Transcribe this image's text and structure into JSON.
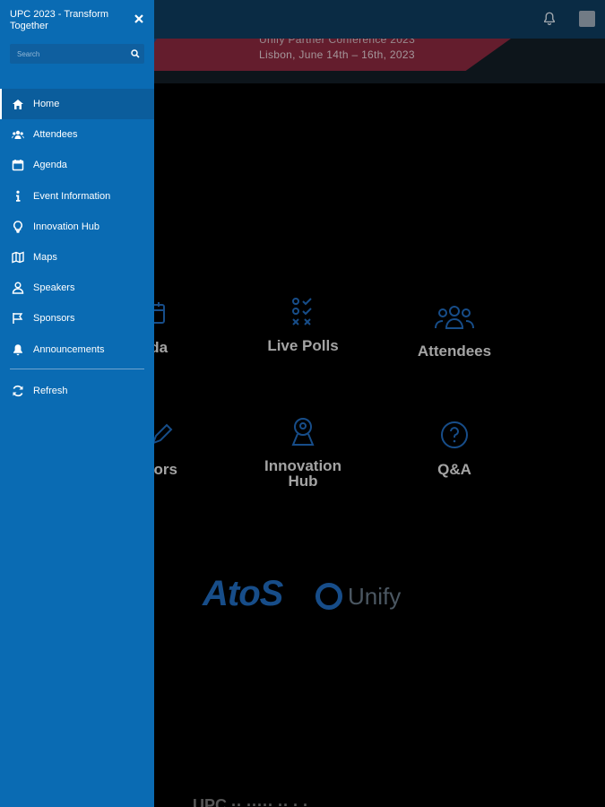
{
  "background": {
    "banner": {
      "line1": "Unify Partner Conference 2023",
      "line2": "Lisbon, June 14th – 16th, 2023"
    },
    "tiles": [
      {
        "label": "nda",
        "icon": "calendar-icon"
      },
      {
        "label": "Live Polls",
        "icon": "poll-checklist-icon"
      },
      {
        "label": "Attendees",
        "icon": "group-icon"
      },
      {
        "label": "sors",
        "icon": "pencil-icon"
      },
      {
        "label": "Innovation Hub",
        "icon": "location-pin-icon"
      },
      {
        "label": "Q&A",
        "icon": "question-circle-icon"
      }
    ],
    "logos": {
      "atos": "AtoS",
      "unify": "Unify"
    },
    "bottom_text": "UPC ·· ····· ·· · ·"
  },
  "drawer": {
    "title": "UPC 2023 - Transform Together",
    "search_placeholder": "Search",
    "items": [
      {
        "label": "Home",
        "icon": "home-icon",
        "active": true
      },
      {
        "label": "Attendees",
        "icon": "people-icon"
      },
      {
        "label": "Agenda",
        "icon": "calendar-icon"
      },
      {
        "label": "Event Information",
        "icon": "info-icon"
      },
      {
        "label": "Innovation Hub",
        "icon": "lightbulb-icon"
      },
      {
        "label": "Maps",
        "icon": "map-icon"
      },
      {
        "label": "Speakers",
        "icon": "person-icon"
      },
      {
        "label": "Sponsors",
        "icon": "flag-icon"
      },
      {
        "label": "Announcements",
        "icon": "bell-icon"
      }
    ],
    "refresh_label": "Refresh"
  },
  "colors": {
    "drawer": "#0a6bb3",
    "topbar": "#0d3554",
    "accent": "#1d5fa8"
  }
}
